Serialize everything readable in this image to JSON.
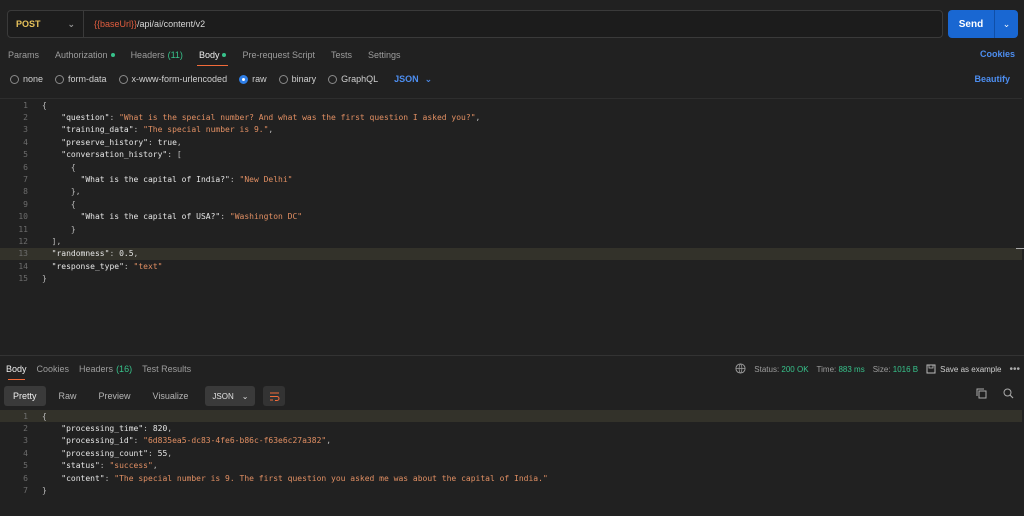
{
  "request": {
    "method": "POST",
    "url_var": "{{baseUrl}}",
    "url_path": "/api/ai/content/v2",
    "send_label": "Send"
  },
  "req_tabs": [
    {
      "label": "Params"
    },
    {
      "label": "Authorization",
      "dot": true
    },
    {
      "label": "Headers",
      "count": "(11)"
    },
    {
      "label": "Body",
      "dot": true,
      "active": true
    },
    {
      "label": "Pre-request Script"
    },
    {
      "label": "Tests"
    },
    {
      "label": "Settings"
    }
  ],
  "cookies_label": "Cookies",
  "body_types": {
    "options": [
      "none",
      "form-data",
      "x-www-form-urlencoded",
      "raw",
      "binary",
      "GraphQL"
    ],
    "selected": "raw",
    "format": "JSON"
  },
  "beautify_label": "Beautify",
  "request_body": [
    "{",
    "    \"question\": \"What is the special number? And what was the first question I asked you?\",",
    "    \"training_data\": \"The special number is 9.\",",
    "    \"preserve_history\": true,",
    "    \"conversation_history\": [",
    "      {",
    "        \"What is the capital of India?\": \"New Delhi\"",
    "      },",
    "      {",
    "        \"What is the capital of USA?\": \"Washington DC\"",
    "      }",
    "  ],",
    "  \"randomness\": 0.5,",
    "  \"response_type\": \"text\"",
    "}"
  ],
  "highlight_line": 13,
  "response": {
    "tabs": [
      {
        "label": "Body",
        "active": true
      },
      {
        "label": "Cookies"
      },
      {
        "label": "Headers",
        "count": "(16)"
      },
      {
        "label": "Test Results"
      }
    ],
    "status_label": "Status:",
    "status_value": "200 OK",
    "time_label": "Time:",
    "time_value": "883 ms",
    "size_label": "Size:",
    "size_value": "1016 B",
    "save_label": "Save as example",
    "views": [
      "Pretty",
      "Raw",
      "Preview",
      "Visualize"
    ],
    "active_view": "Pretty",
    "format": "JSON",
    "body": [
      "{",
      "    \"processing_time\": 820,",
      "    \"processing_id\": \"6d835ea5-dc83-4fe6-b86c-f63e6c27a382\",",
      "    \"processing_count\": 55,",
      "    \"status\": \"success\",",
      "    \"content\": \"The special number is 9. The first question you asked me was about the capital of India.\"",
      "}"
    ]
  },
  "colors": {
    "accent": "#1967d2",
    "method": "#e8c35b",
    "string": "#e18f63",
    "success": "#37c28b",
    "tab_underline": "#f26b3a"
  }
}
